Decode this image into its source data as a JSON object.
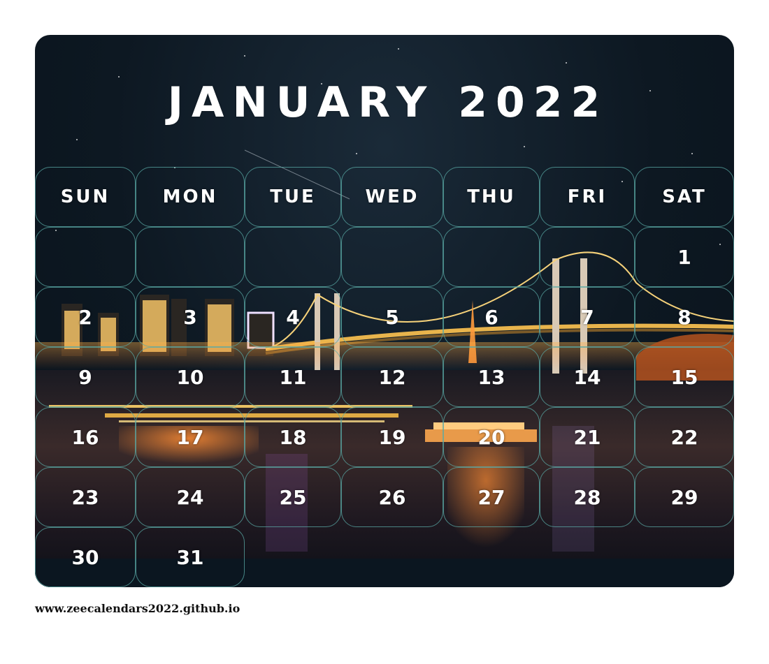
{
  "calendar": {
    "title": "JANUARY 2022",
    "weekdays": [
      "SUN",
      "MON",
      "TUE",
      "WED",
      "THU",
      "FRI",
      "SAT"
    ],
    "weeks": [
      [
        "",
        "",
        "",
        "",
        "",
        "",
        "1"
      ],
      [
        "2",
        "3",
        "4",
        "5",
        "6",
        "7",
        "8"
      ],
      [
        "9",
        "10",
        "11",
        "12",
        "13",
        "14",
        "15"
      ],
      [
        "16",
        "17",
        "18",
        "19",
        "20",
        "21",
        "22"
      ],
      [
        "23",
        "24",
        "25",
        "26",
        "27",
        "28",
        "29"
      ],
      [
        "30",
        "31",
        "",
        "",
        "",
        "",
        ""
      ]
    ]
  },
  "footer": {
    "url": "www.zeecalendars2022.github.io"
  },
  "colors": {
    "sky": "#0d1822",
    "grid_border": "#5aaaa5",
    "text": "#ffffff",
    "city_lights": "#f2b64a"
  }
}
